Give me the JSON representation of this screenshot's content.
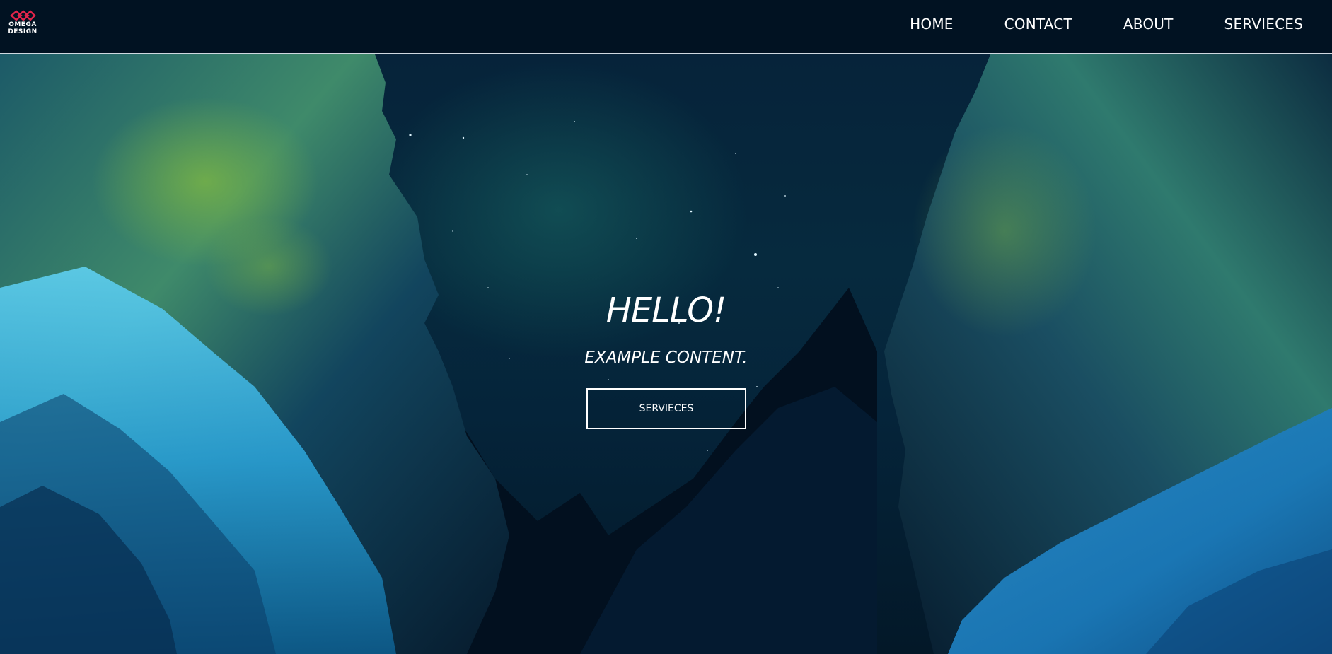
{
  "brand": {
    "logo_line1": "OMEGA",
    "logo_line2": "DESIGN",
    "logo_color": "#e0244a"
  },
  "nav": {
    "items": [
      {
        "label": "HOME"
      },
      {
        "label": "CONTACT"
      },
      {
        "label": "ABOUT"
      },
      {
        "label": "SERVIECES"
      }
    ]
  },
  "hero": {
    "title": "HELLO!",
    "subtitle": "EXAMPLE CONTENT.",
    "button_label": "SERVIECES",
    "background_subject": "night mountain canyon with stars"
  },
  "colors": {
    "navbar_bg": "#011222",
    "text": "#ffffff",
    "accent": "#e0244a"
  }
}
